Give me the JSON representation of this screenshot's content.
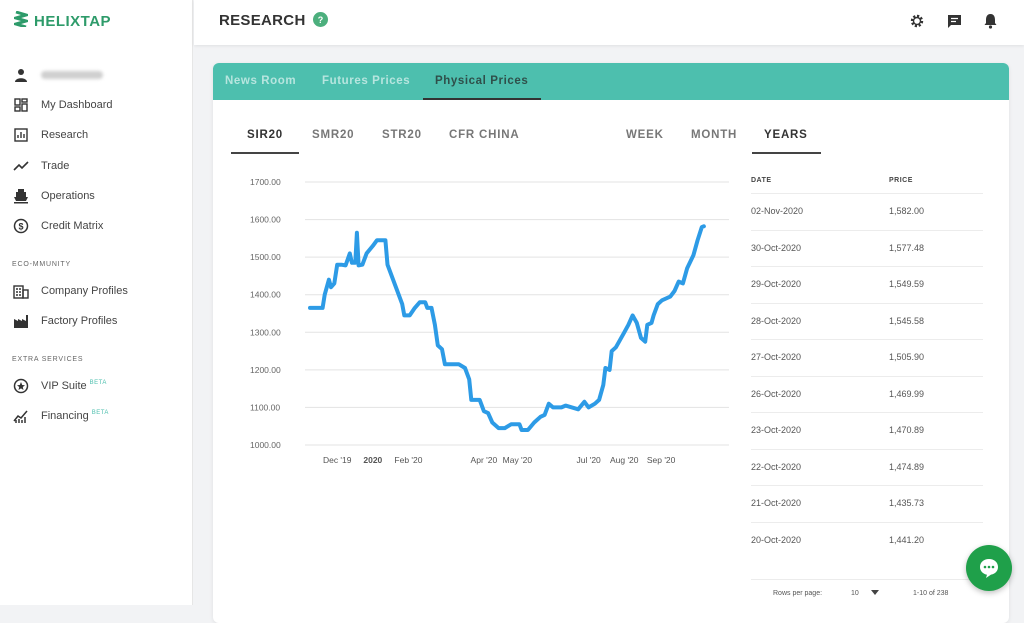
{
  "brand": {
    "name": "HELIXTAP",
    "color": "#2e9b6a"
  },
  "sidebar": {
    "items": [
      {
        "label": "My Dashboard",
        "icon": "dashboard-icon"
      },
      {
        "label": "Research",
        "icon": "chart-box-icon"
      },
      {
        "label": "Trade",
        "icon": "trend-line-icon"
      },
      {
        "label": "Operations",
        "icon": "ship-icon"
      },
      {
        "label": "Credit Matrix",
        "icon": "dollar-circle-icon"
      }
    ],
    "section_community": "ECO-MMUNITY",
    "community_items": [
      {
        "label": "Company Profiles",
        "icon": "building-icon"
      },
      {
        "label": "Factory Profiles",
        "icon": "factory-icon"
      }
    ],
    "section_extra": "EXTRA SERVICES",
    "extra_items": [
      {
        "label": "VIP Suite",
        "badge": "BETA",
        "icon": "star-circle-icon"
      },
      {
        "label": "Financing",
        "badge": "BETA",
        "icon": "finance-chart-icon"
      }
    ]
  },
  "header": {
    "title": "RESEARCH",
    "help": "?"
  },
  "tabs": [
    "News Room",
    "Futures Prices",
    "Physical Prices"
  ],
  "active_tab": "Physical Prices",
  "product_tabs": [
    "SIR20",
    "SMR20",
    "STR20",
    "CFR CHINA"
  ],
  "range_tabs": [
    "WEEK",
    "MONTH",
    "YEARS"
  ],
  "table": {
    "headers": {
      "date": "DATE",
      "price": "PRICE"
    },
    "rows": [
      {
        "date": "02-Nov-2020",
        "price": "1,582.00"
      },
      {
        "date": "30-Oct-2020",
        "price": "1,577.48"
      },
      {
        "date": "29-Oct-2020",
        "price": "1,549.59"
      },
      {
        "date": "28-Oct-2020",
        "price": "1,545.58"
      },
      {
        "date": "27-Oct-2020",
        "price": "1,505.90"
      },
      {
        "date": "26-Oct-2020",
        "price": "1,469.99"
      },
      {
        "date": "23-Oct-2020",
        "price": "1,470.89"
      },
      {
        "date": "22-Oct-2020",
        "price": "1,474.89"
      },
      {
        "date": "21-Oct-2020",
        "price": "1,435.73"
      },
      {
        "date": "20-Oct-2020",
        "price": "1,441.20"
      }
    ],
    "rows_per_page_label": "Rows per page:",
    "rows_per_page": "10",
    "pagination": "1-10 of 238"
  },
  "chart_data": {
    "type": "line",
    "ylim": [
      1000,
      1700
    ],
    "y_ticks": [
      "1700.00",
      "1600.00",
      "1500.00",
      "1400.00",
      "1300.00",
      "1200.00",
      "1100.00",
      "1000.00"
    ],
    "x_ticks": [
      "Dec '19",
      "2020",
      "Feb '20",
      "Apr '20",
      "May '20",
      "Jul '20",
      "Aug '20",
      "Sep '20"
    ],
    "xlim": [
      0,
      1
    ],
    "color": "#2d9be6",
    "series": [
      {
        "values": [
          [
            0.0,
            1365
          ],
          [
            0.03,
            1365
          ],
          [
            0.035,
            1400
          ],
          [
            0.045,
            1440
          ],
          [
            0.05,
            1420
          ],
          [
            0.058,
            1430
          ],
          [
            0.065,
            1480
          ],
          [
            0.075,
            1480
          ],
          [
            0.085,
            1478
          ],
          [
            0.095,
            1510
          ],
          [
            0.1,
            1485
          ],
          [
            0.108,
            1485
          ],
          [
            0.112,
            1565
          ],
          [
            0.116,
            1478
          ],
          [
            0.125,
            1480
          ],
          [
            0.135,
            1510
          ],
          [
            0.15,
            1530
          ],
          [
            0.16,
            1545
          ],
          [
            0.175,
            1545
          ],
          [
            0.18,
            1545
          ],
          [
            0.185,
            1480
          ],
          [
            0.205,
            1420
          ],
          [
            0.22,
            1375
          ],
          [
            0.225,
            1345
          ],
          [
            0.238,
            1345
          ],
          [
            0.25,
            1365
          ],
          [
            0.262,
            1380
          ],
          [
            0.275,
            1380
          ],
          [
            0.28,
            1365
          ],
          [
            0.29,
            1365
          ],
          [
            0.298,
            1320
          ],
          [
            0.305,
            1265
          ],
          [
            0.315,
            1255
          ],
          [
            0.322,
            1215
          ],
          [
            0.335,
            1215
          ],
          [
            0.355,
            1215
          ],
          [
            0.37,
            1205
          ],
          [
            0.38,
            1175
          ],
          [
            0.385,
            1120
          ],
          [
            0.405,
            1120
          ],
          [
            0.415,
            1090
          ],
          [
            0.425,
            1085
          ],
          [
            0.435,
            1060
          ],
          [
            0.45,
            1045
          ],
          [
            0.465,
            1045
          ],
          [
            0.48,
            1055
          ],
          [
            0.5,
            1055
          ],
          [
            0.505,
            1040
          ],
          [
            0.52,
            1040
          ],
          [
            0.535,
            1060
          ],
          [
            0.55,
            1075
          ],
          [
            0.56,
            1080
          ],
          [
            0.57,
            1110
          ],
          [
            0.58,
            1100
          ],
          [
            0.6,
            1100
          ],
          [
            0.61,
            1105
          ],
          [
            0.625,
            1100
          ],
          [
            0.64,
            1095
          ],
          [
            0.655,
            1115
          ],
          [
            0.665,
            1100
          ],
          [
            0.68,
            1110
          ],
          [
            0.69,
            1120
          ],
          [
            0.7,
            1160
          ],
          [
            0.705,
            1205
          ],
          [
            0.715,
            1200
          ],
          [
            0.72,
            1250
          ],
          [
            0.73,
            1260
          ],
          [
            0.74,
            1280
          ],
          [
            0.75,
            1300
          ],
          [
            0.76,
            1320
          ],
          [
            0.77,
            1345
          ],
          [
            0.78,
            1325
          ],
          [
            0.79,
            1285
          ],
          [
            0.8,
            1275
          ],
          [
            0.805,
            1320
          ],
          [
            0.815,
            1325
          ],
          [
            0.82,
            1345
          ],
          [
            0.83,
            1375
          ],
          [
            0.84,
            1385
          ],
          [
            0.86,
            1395
          ],
          [
            0.87,
            1410
          ],
          [
            0.88,
            1435
          ],
          [
            0.89,
            1430
          ],
          [
            0.9,
            1470
          ],
          [
            0.915,
            1505
          ],
          [
            0.925,
            1545
          ],
          [
            0.935,
            1580
          ],
          [
            0.94,
            1582
          ]
        ]
      }
    ]
  },
  "icons": {
    "settings": "gear-icon",
    "messages": "message-square-icon",
    "notifications": "bell-icon",
    "chat": "chat-bubble-icon"
  }
}
